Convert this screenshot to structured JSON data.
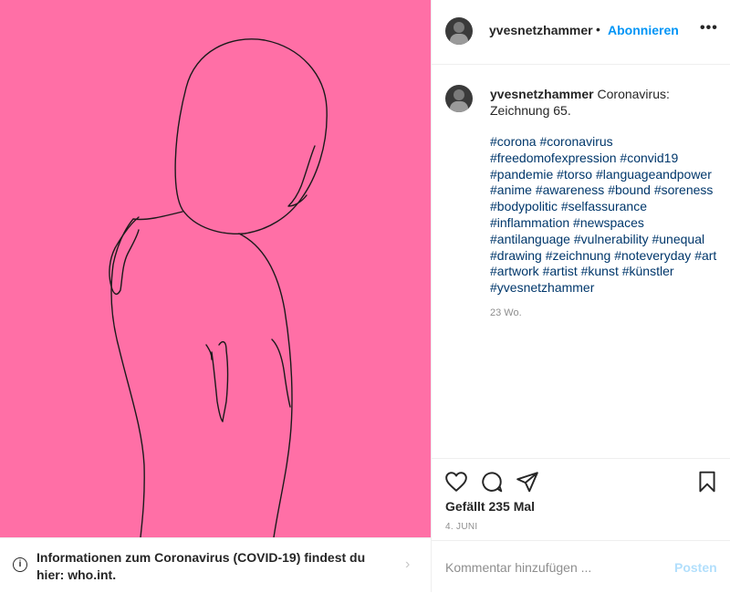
{
  "post": {
    "username": "yvesnetzhammer",
    "follow_label": "Abonnieren",
    "dot": "•",
    "more_label": "•••",
    "caption_text": "Coronavirus: Zeichnung 65.",
    "hashtags": [
      "#corona",
      "#coronavirus",
      "#freedomofexpression",
      "#convid19",
      "#pandemie",
      "#torso",
      "#languageandpower",
      "#anime",
      "#awareness",
      "#bound",
      "#soreness",
      "#bodypolitic",
      "#selfassurance",
      "#inflammation",
      "#newspaces",
      "#antilanguage",
      "#vulnerability",
      "#unequal",
      "#drawing",
      "#zeichnung",
      "#noteveryday",
      "#art",
      "#artwork",
      "#artist",
      "#kunst",
      "#künstler",
      "#yvesnetzhammer"
    ],
    "age": "23 Wo.",
    "likes": "Gefällt 235 Mal",
    "date": "4. JUNI"
  },
  "comment": {
    "placeholder": "Kommentar hinzufügen ...",
    "post_label": "Posten"
  },
  "covid_banner": {
    "text": "Informationen zum Coronavirus (COVID-19) findest du hier: who.int."
  },
  "colors": {
    "image_background": "#ff6fa6",
    "link": "#0095f6",
    "hashtag": "#00376b"
  },
  "icons": [
    "heart-icon",
    "comment-icon",
    "share-icon",
    "bookmark-icon",
    "info-icon",
    "chevron-right-icon"
  ]
}
